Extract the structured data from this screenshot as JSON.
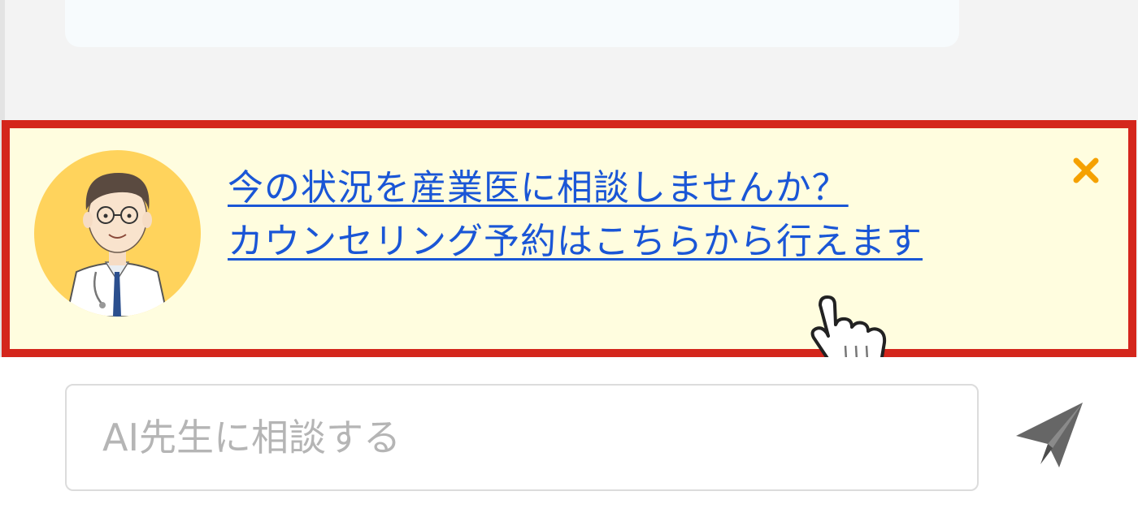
{
  "consult_banner": {
    "line1": "今の状況を産業医に相談しませんか？",
    "line2": "カウンセリング予約はこちらから行えます",
    "avatar_icon": "doctor-avatar-icon",
    "close_icon": "close-icon"
  },
  "chat": {
    "input_placeholder": "AI先生に相談する",
    "input_value": "",
    "send_icon": "paper-plane-icon"
  },
  "colors": {
    "banner_border": "#d4261c",
    "banner_background": "#fffddf",
    "link": "#1a56d6",
    "close_icon": "#f5a100",
    "avatar_background": "#ffd35c",
    "send_icon": "#666666"
  }
}
